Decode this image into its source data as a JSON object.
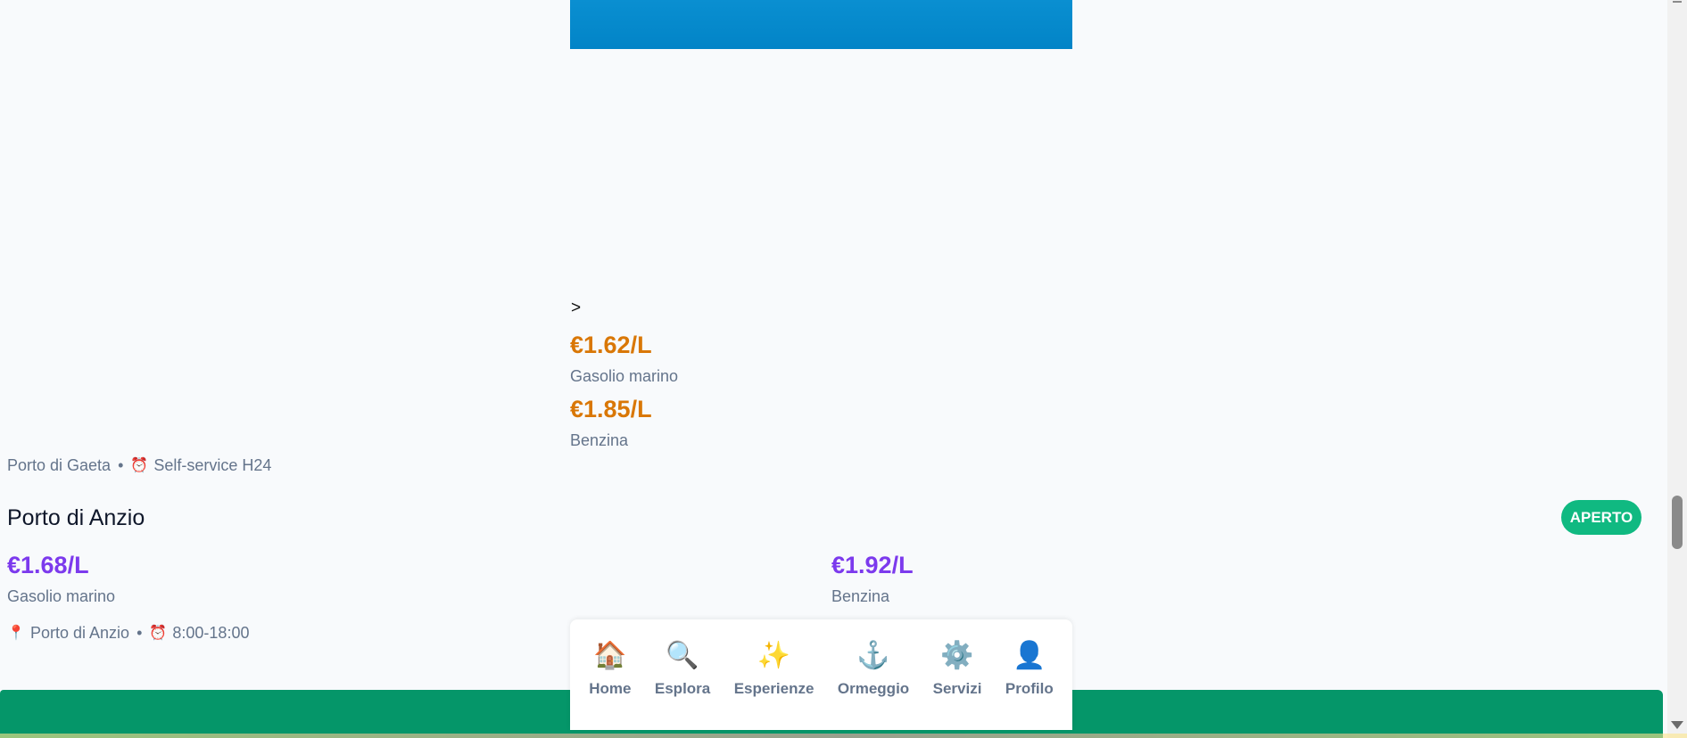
{
  "prev_card": {
    "arrow": ">",
    "fuel_1": {
      "price": "€1.62/L",
      "label": "Gasolio marino"
    },
    "fuel_2": {
      "price": "€1.85/L",
      "label": "Benzina"
    },
    "location": "Porto di Gaeta",
    "separator": "•",
    "hours": "Self-service H24"
  },
  "card": {
    "title": "Porto di Anzio",
    "status": "APERTO",
    "fuel_1": {
      "price": "€1.68/L",
      "label": "Gasolio marino"
    },
    "fuel_2": {
      "price": "€1.92/L",
      "label": "Benzina"
    },
    "location": "Porto di Anzio",
    "separator": "•",
    "hours": "8:00-18:00"
  },
  "nav": {
    "items": [
      {
        "label": "Home",
        "icon": "🏠"
      },
      {
        "label": "Esplora",
        "icon": "🔍"
      },
      {
        "label": "Esperienze",
        "icon": "✨"
      },
      {
        "label": "Ormeggio",
        "icon": "⚓"
      },
      {
        "label": "Servizi",
        "icon": "⚙️"
      },
      {
        "label": "Profilo",
        "icon": "👤"
      }
    ]
  },
  "icons": {
    "pin": "📍",
    "clock": "⏰"
  },
  "colors": {
    "accent_orange": "#d97706",
    "accent_purple": "#7c3aed",
    "status_green": "#10b981",
    "banner_blue": "#0284c7",
    "footer_green": "#059669"
  }
}
